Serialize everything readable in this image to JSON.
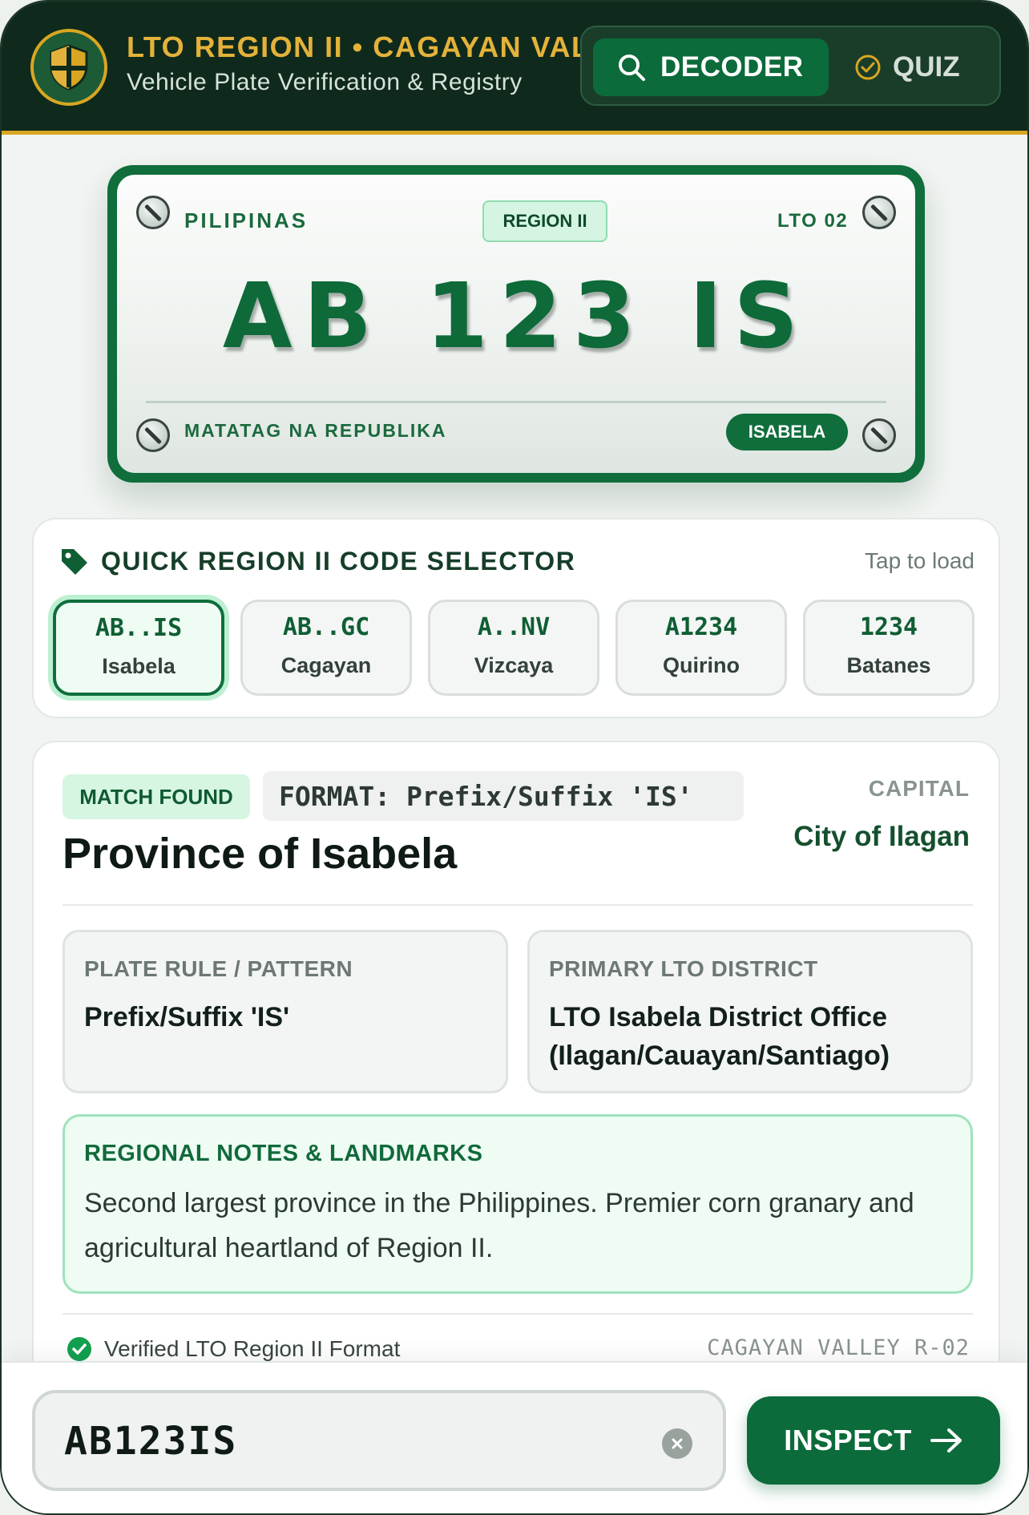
{
  "header": {
    "title": "LTO REGION II • CAGAYAN VALLEY",
    "subtitle": "Vehicle Plate Verification & Registry",
    "tabs": [
      {
        "label": "DECODER",
        "active": true,
        "icon": "search-icon"
      },
      {
        "label": "QUIZ",
        "active": false,
        "icon": "check-circle-icon"
      }
    ]
  },
  "plate": {
    "country": "PILIPINAS",
    "region_badge": "REGION II",
    "office_code": "LTO 02",
    "number": "AB 123 IS",
    "motto": "MATATAG NA REPUBLIKA",
    "province_pill": "ISABELA"
  },
  "selector": {
    "title": "QUICK REGION II CODE SELECTOR",
    "hint": "Tap to load",
    "chips": [
      {
        "code": "AB..IS",
        "name": "Isabela",
        "active": true
      },
      {
        "code": "AB..GC",
        "name": "Cagayan",
        "active": false
      },
      {
        "code": "A..NV",
        "name": "Vizcaya",
        "active": false
      },
      {
        "code": "A1234",
        "name": "Quirino",
        "active": false
      },
      {
        "code": "1234",
        "name": "Batanes",
        "active": false
      }
    ]
  },
  "result": {
    "match_label": "MATCH FOUND",
    "format_label": "FORMAT: Prefix/Suffix 'IS'",
    "province": "Province of Isabela",
    "capital_label": "CAPITAL",
    "capital_value": "City of Ilagan",
    "rule_label": "PLATE RULE / PATTERN",
    "rule_value": "Prefix/Suffix 'IS'",
    "district_label": "PRIMARY LTO DISTRICT",
    "district_value": "LTO Isabela District Office (Ilagan/Cauayan/Santiago)",
    "notes_label": "REGIONAL NOTES & LANDMARKS",
    "notes_text": "Second largest province in the Philippines. Premier corn granary and agricultural heartland of Region II.",
    "verified_text": "Verified LTO Region II Format",
    "region_code": "CAGAYAN VALLEY R-02"
  },
  "input": {
    "value": "AB123IS",
    "button_label": "INSPECT"
  },
  "colors": {
    "brand_green": "#0b6b3a",
    "header_bg": "#0f2a1c",
    "accent_gold": "#d8a622"
  }
}
